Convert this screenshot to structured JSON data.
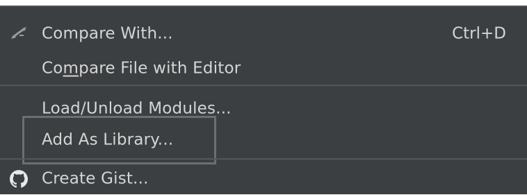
{
  "menu": {
    "items": [
      {
        "label_pre": "Compare With...",
        "shortcut": "Ctrl+D",
        "icon": "compare-arrows-icon"
      },
      {
        "label_pre": "Co",
        "label_mnemonic": "m",
        "label_post": "pare File with Editor"
      },
      {
        "label_pre": "Load/Unload Modules..."
      },
      {
        "label_pre": "Add As Library..."
      },
      {
        "label_pre": "Create Gist...",
        "icon": "github-icon"
      }
    ]
  },
  "colors": {
    "background": "#3c3f41",
    "text": "#d5d5d5",
    "separator": "#555859",
    "highlight_border": "#6c6e70"
  }
}
